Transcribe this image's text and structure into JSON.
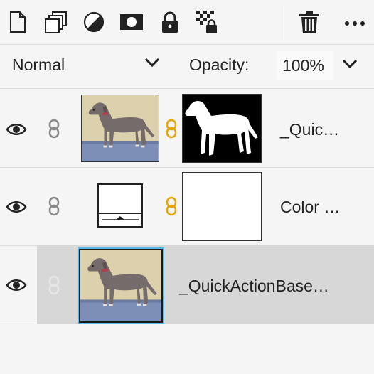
{
  "toolbar": {
    "icons": [
      "new-layer-icon",
      "duplicate-layer-icon",
      "adjustment-layer-icon",
      "add-mask-icon",
      "lock-icon",
      "lock-transparency-icon",
      "delete-icon",
      "more-icon"
    ]
  },
  "blend": {
    "mode": "Normal",
    "opacity_label": "Opacity:",
    "opacity_value": "100%"
  },
  "layers": [
    {
      "name": "_Quic…",
      "type": "image-with-mask",
      "visible": true,
      "linked": true
    },
    {
      "name": "Color …",
      "type": "color-fill-with-mask",
      "visible": true,
      "linked": true
    },
    {
      "name": "_QuickActionBase…",
      "type": "image",
      "visible": true,
      "linked": false,
      "selected": true
    }
  ],
  "colors": {
    "panel_bg": "#f5f5f5",
    "selected_row": "#d7d7d7",
    "selected_border": "#5ab8e8",
    "link_active": "#e8a400"
  }
}
